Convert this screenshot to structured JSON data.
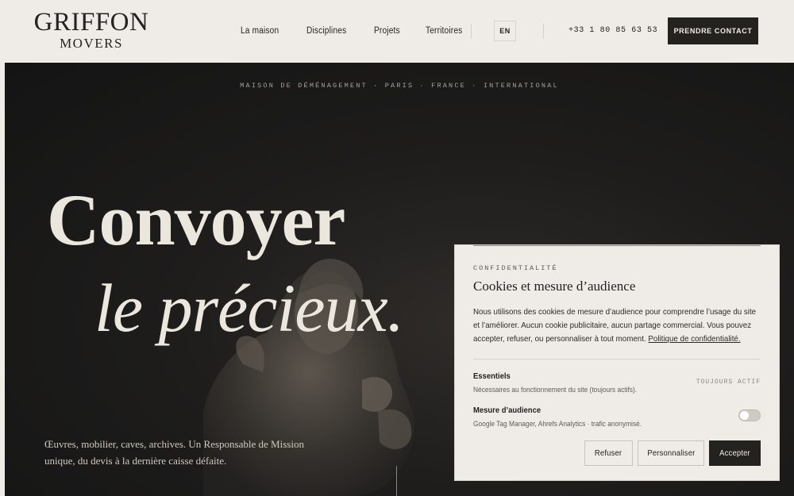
{
  "header": {
    "logo_main": "GRIFFON",
    "logo_sub": "MOVERS",
    "nav": [
      "La maison",
      "Disciplines",
      "Projets",
      "Territoires"
    ],
    "lang": "EN",
    "phone": "+33 1 80 85 63 53",
    "cta": "PRENDRE CONTACT"
  },
  "hero": {
    "kicker": "MAISON DE DÉMÉNAGEMENT · PARIS · FRANCE · INTERNATIONAL",
    "title_line1": "Convoyer",
    "title_line2": "le précieux.",
    "lede": "Œuvres, mobilier, caves, archives. Un Responsable de Mission unique, du devis à la dernière caisse défaite."
  },
  "cookie": {
    "kicker": "CONFIDENTIALITÉ",
    "title": "Cookies et mesure d’audience",
    "body": "Nous utilisons des cookies de mesure d’audience pour comprendre l’usage du site et l’améliorer. Aucun cookie publicitaire, aucun partage commercial. Vous pouvez accepter, refuser, ou personnaliser à tout moment.",
    "policy_link": "Politique de confidentialité.",
    "essentials_title": "Essentiels",
    "essentials_desc": "Nécessaires au fonctionnement du site (toujours actifs).",
    "always_active": "TOUJOURS ACTIF",
    "audience_title": "Mesure d’audience",
    "audience_desc": "Google Tag Manager, Ahrefs Analytics · trafic anonymisé.",
    "audience_enabled": false,
    "refuse": "Refuser",
    "customize": "Personnaliser",
    "accept": "Accepter"
  },
  "colors": {
    "background": "#efece7",
    "hero_dark": "#1e1d1c",
    "ink": "#24221f",
    "hero_text": "#ece7de"
  }
}
